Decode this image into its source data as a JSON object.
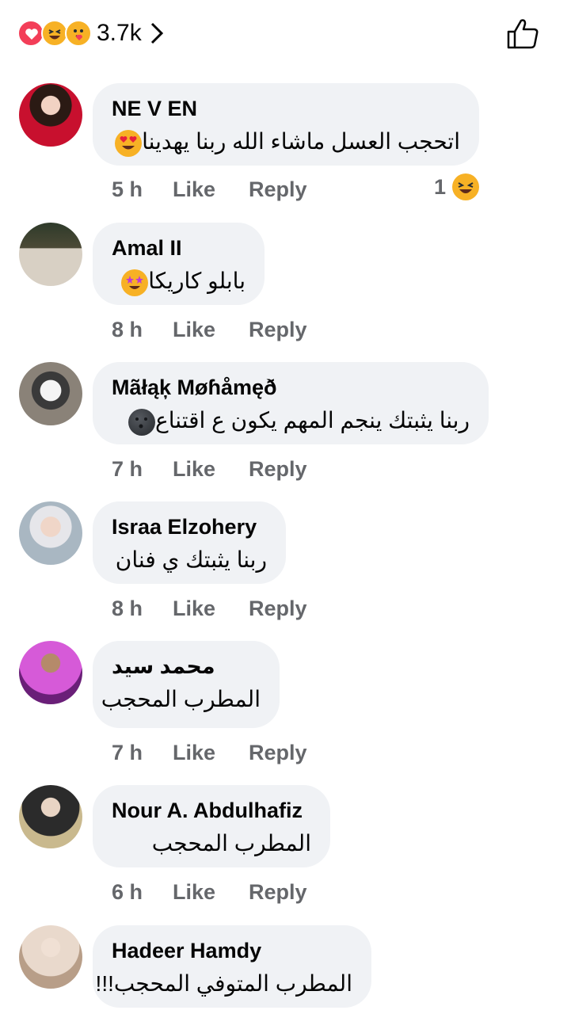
{
  "header": {
    "reaction_count": "3.7k",
    "reactions": [
      "heart-icon",
      "haha-icon",
      "care-icon"
    ]
  },
  "actions": {
    "like": "Like",
    "reply": "Reply"
  },
  "comments": [
    {
      "name": "NE V EN",
      "text": "اتحجب العسل ماشاء الله ربنا يهدينا",
      "emoji": "heart-eyes",
      "time": "5 h",
      "reaction_count": "1",
      "avatar_color": "#c8102e"
    },
    {
      "name": "Amal II",
      "text": "بابلو كاريكا",
      "emoji": "star-struck",
      "time": "8 h",
      "reaction_count": "",
      "avatar_color": "#3d3a2a"
    },
    {
      "name": "Mãłąķ Møɦåmęð",
      "text": "ربنا يثبتك ينجم المهم يكون ع اقتناع",
      "emoji": "new-moon-face",
      "time": "7 h",
      "reaction_count": "",
      "avatar_color": "#6e6a64"
    },
    {
      "name": "Israa Elzohery",
      "text": "ربنا يثبتك ي فنان",
      "emoji": "",
      "time": "8 h",
      "reaction_count": "",
      "avatar_color": "#b9c3cc"
    },
    {
      "name": "محمد سيد",
      "text": "المطرب المحجب",
      "emoji": "",
      "time": "7 h",
      "reaction_count": "",
      "avatar_color": "#7a2a8c"
    },
    {
      "name": "Nour A. Abdulhafiz",
      "text": "المطرب المحجب",
      "emoji": "",
      "time": "6 h",
      "reaction_count": "",
      "avatar_color": "#2b2b2b"
    },
    {
      "name": "Hadeer Hamdy",
      "text": "المطرب المتوفي المحجب!!!",
      "emoji": "",
      "time": "",
      "reaction_count": "",
      "avatar_color": "#d9c7b8"
    }
  ]
}
